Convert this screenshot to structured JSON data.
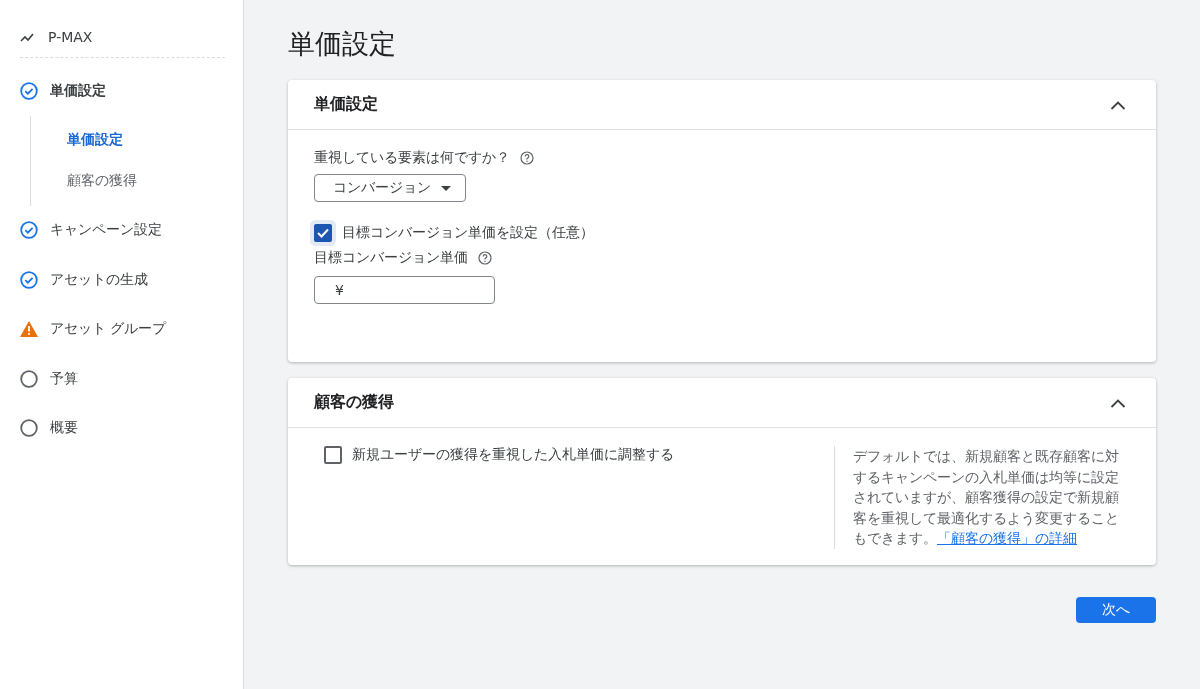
{
  "sidebar": {
    "campaign": "P-MAX",
    "items": [
      {
        "label": "単価設定",
        "kind": "done",
        "selected": true,
        "children": [
          {
            "label": "単価設定",
            "selected": true
          },
          {
            "label": "顧客の獲得",
            "selected": false
          }
        ]
      },
      {
        "label": "キャンペーン設定",
        "kind": "done",
        "selected": false
      },
      {
        "label": "アセットの生成",
        "kind": "done",
        "selected": false
      },
      {
        "label": "アセット グループ",
        "kind": "warning",
        "selected": false
      },
      {
        "label": "予算",
        "kind": "todo",
        "selected": false
      },
      {
        "label": "概要",
        "kind": "todo",
        "selected": false
      }
    ]
  },
  "page_title": "単価設定",
  "bidding_card": {
    "title": "単価設定",
    "expanded": true,
    "focus_label": "重視している要素は何ですか？",
    "focus_value": "コンバージョン",
    "target_checkbox": {
      "label": "目標コンバージョン単価を設定（任意）",
      "checked": true
    },
    "target_label": "目標コンバージョン単価",
    "target_prefix": "¥"
  },
  "acquisition_card": {
    "title": "顧客の獲得",
    "expanded": true,
    "checkbox": {
      "label": "新規ユーザーの獲得を重視した入札単価に調整する",
      "checked": false
    },
    "help_text": "デフォルトでは、新規顧客と既存顧客に対するキャンペーンの入札単価は均等に設定されていますが、顧客獲得の設定で新規顧客を重視して最適化するよう変更することもできます。",
    "help_link": "「顧客の獲得」の詳細"
  },
  "next_button": "次へ"
}
